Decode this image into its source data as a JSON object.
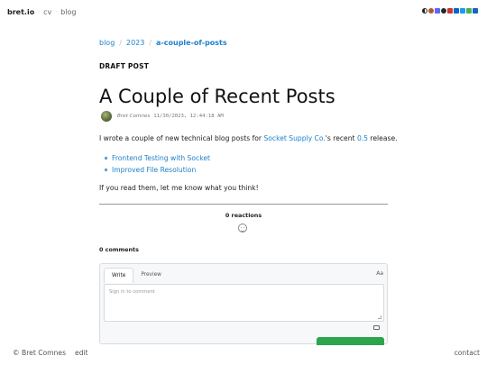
{
  "nav": {
    "brand": "bret.io",
    "links": [
      "cv",
      "blog"
    ]
  },
  "header_icons": [
    {
      "name": "theme-toggle-icon",
      "color": "#222222"
    },
    {
      "name": "globe-icon",
      "color": "#b05a2a"
    },
    {
      "name": "mastodon-icon",
      "color": "#6364ff"
    },
    {
      "name": "github-icon",
      "color": "#24292e"
    },
    {
      "name": "npm-icon",
      "color": "#cb3837"
    },
    {
      "name": "linkedin-icon",
      "color": "#0a66c2"
    },
    {
      "name": "bluesky-icon",
      "color": "#1d9bf0"
    },
    {
      "name": "email-icon",
      "color": "#4caf50"
    },
    {
      "name": "rss-icon",
      "color": "#1565c0"
    }
  ],
  "breadcrumb": [
    "blog",
    "2023",
    "a-couple-of-posts"
  ],
  "post": {
    "status": "DRAFT POST",
    "title": "A Couple of Recent Posts",
    "author": "Bret Comnes",
    "date": "11/30/2023, 12:44:18 AM",
    "intro": {
      "before": "I wrote a couple of new technical blog posts for ",
      "link1": "Socket Supply Co.",
      "middle": "'s recent ",
      "link2": "0.5",
      "after": " release."
    },
    "links": [
      "Frontend Testing with Socket",
      "Improved File Resolution"
    ],
    "outro": "If you read them, let me know what you think!"
  },
  "reactions": {
    "label": "0 reactions"
  },
  "comments": {
    "count_label": "0 comments",
    "tabs": [
      "Write",
      "Preview"
    ],
    "aa_label": "Aa",
    "placeholder": "Sign in to comment"
  },
  "footer": {
    "copyright": "© Bret Comnes",
    "edit": "edit",
    "contact": "contact"
  },
  "colors": {
    "link": "#1f80c9",
    "signin_button": "#2da44e"
  }
}
